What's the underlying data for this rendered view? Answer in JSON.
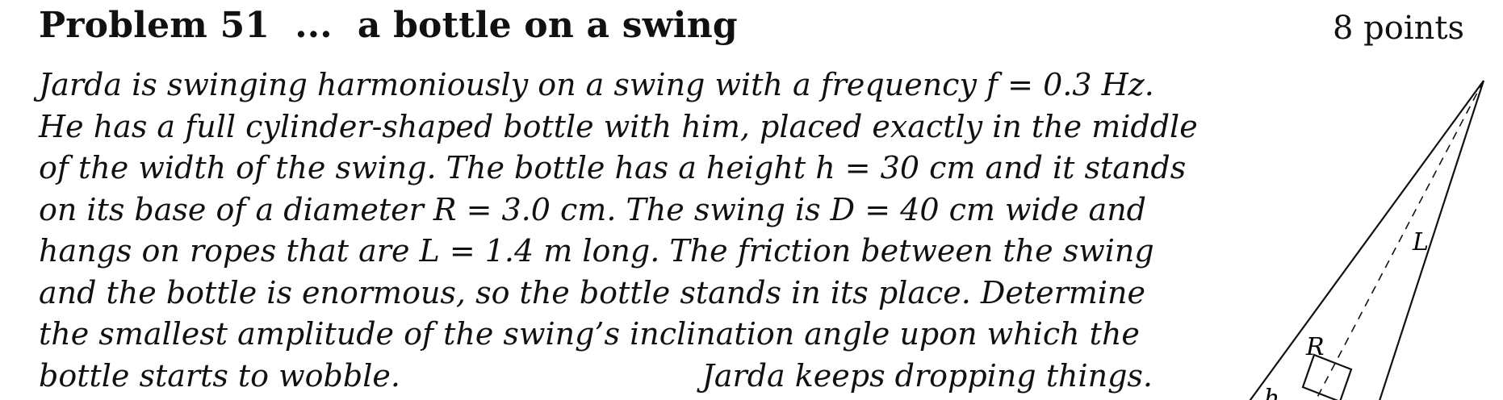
{
  "header": {
    "problem_label": "Problem 51",
    "ellipsis": "...",
    "problem_title": "a bottle on a swing",
    "points": "8 points"
  },
  "text": {
    "lines": [
      "Jarda is swinging harmoniously on a swing with a frequency f = 0.3 Hz.",
      "He has a full cylinder-shaped bottle with him, placed exactly in the middle",
      "of the width of the swing. The bottle has a height h = 30 cm and it stands",
      "on its base of a diameter R = 3.0 cm. The swing is D = 40 cm wide and",
      "hangs on ropes that are L = 1.4 m long. The friction between the swing",
      "and the bottle is enormous, so the bottle stands in its place. Determine",
      "the smallest amplitude of the swing’s inclination angle upon which the"
    ],
    "last_line": "bottle starts to wobble.",
    "signature": "Jarda keeps dropping things."
  },
  "figure": {
    "label_L": "L",
    "label_R": "R",
    "label_h": "h"
  }
}
